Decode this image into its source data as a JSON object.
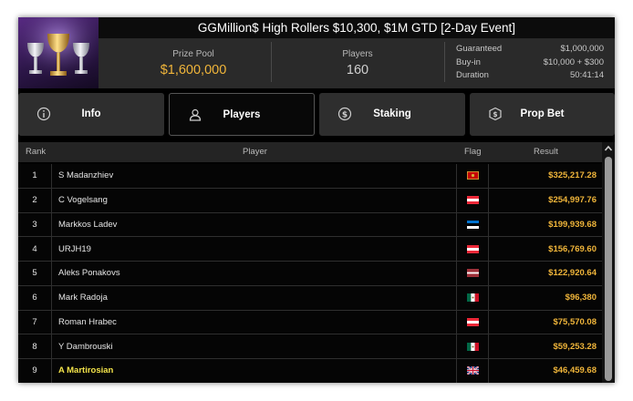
{
  "header": {
    "title": "GGMillion$ High Rollers $10,300, $1M GTD [2-Day Event]",
    "prize_pool_label": "Prize Pool",
    "prize_pool_value": "$1,600,000",
    "players_label": "Players",
    "players_value": "160",
    "details": [
      {
        "label": "Guaranteed",
        "value": "$1,000,000"
      },
      {
        "label": "Buy-in",
        "value": "$10,000 + $300"
      },
      {
        "label": "Duration",
        "value": "50:41:14"
      }
    ]
  },
  "tabs": [
    {
      "label": "Info",
      "icon": "info-icon"
    },
    {
      "label": "Players",
      "icon": "user-icon"
    },
    {
      "label": "Staking",
      "icon": "staking-icon"
    },
    {
      "label": "Prop Bet",
      "icon": "prop-bet-icon"
    }
  ],
  "active_tab": "Players",
  "table": {
    "columns": [
      "Rank",
      "Player",
      "Flag",
      "Result"
    ],
    "rows": [
      {
        "rank": "1",
        "player": "S Madanzhiev",
        "flag": "montenegro",
        "result": "$325,217.28"
      },
      {
        "rank": "2",
        "player": "C Vogelsang",
        "flag": "austria",
        "result": "$254,997.76"
      },
      {
        "rank": "3",
        "player": "Markkos Ladev",
        "flag": "estonia",
        "result": "$199,939.68"
      },
      {
        "rank": "4",
        "player": "URJH19",
        "flag": "austria",
        "result": "$156,769.60"
      },
      {
        "rank": "5",
        "player": "Aleks Ponakovs",
        "flag": "latvia",
        "result": "$122,920.64"
      },
      {
        "rank": "6",
        "player": "Mark Radoja",
        "flag": "mexico",
        "result": "$96,380"
      },
      {
        "rank": "7",
        "player": "Roman Hrabec",
        "flag": "austria",
        "result": "$75,570.08"
      },
      {
        "rank": "8",
        "player": "Y Dambrouski",
        "flag": "mexico",
        "result": "$59,253.28"
      },
      {
        "rank": "9",
        "player": "A Martirosian",
        "flag": "united-kingdom",
        "result": "$46,459.68",
        "highlighted": true
      }
    ]
  },
  "colors": {
    "accent_gold": "#f0b53a",
    "highlight_yellow": "#f3e34a",
    "header_bg": "#2a2a2a",
    "table_bg": "#050505"
  }
}
